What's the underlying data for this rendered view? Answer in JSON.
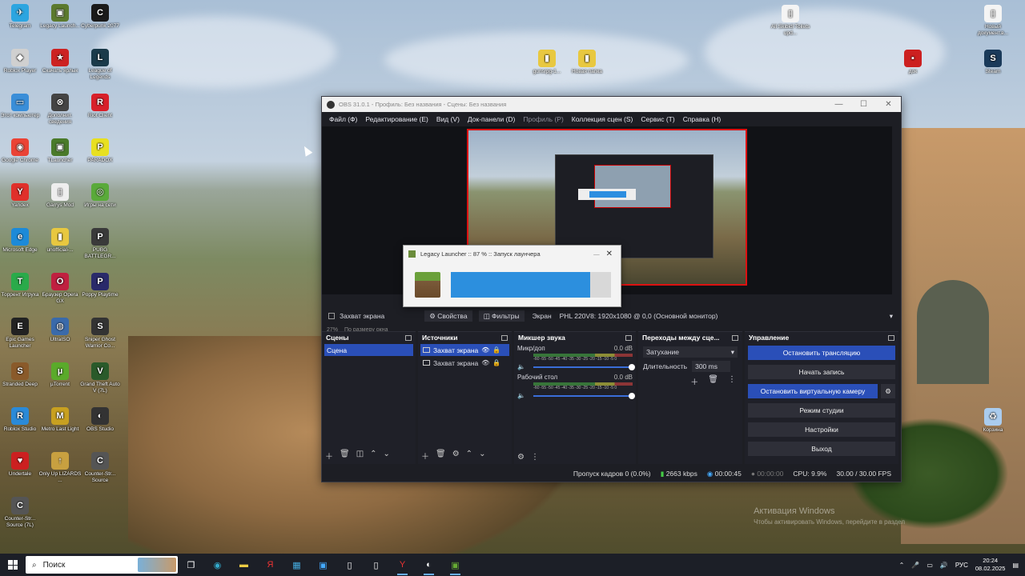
{
  "desktop": {
    "icons_left": [
      {
        "label": "Telegram",
        "color": "#2ca5e0",
        "glyph": "✈"
      },
      {
        "label": "Legacy Launch...",
        "color": "#5c7a2f",
        "glyph": "▣"
      },
      {
        "label": "Cyberpunk 2077",
        "color": "#1a1a1a",
        "glyph": "C"
      },
      {
        "label": "Roblox Player",
        "color": "#d0d0d0",
        "glyph": "◆"
      },
      {
        "label": "Скачать ярлык",
        "color": "#cc2222",
        "glyph": "★"
      },
      {
        "label": "League of Legends",
        "color": "#1a3a4a",
        "glyph": "L"
      },
      {
        "label": "Этот компьютер",
        "color": "#3a8ed8",
        "glyph": "▭"
      },
      {
        "label": "Дополнит. сведения",
        "color": "#444",
        "glyph": "⊗"
      },
      {
        "label": "Riot Client",
        "color": "#d8202a",
        "glyph": "R"
      },
      {
        "label": "Google Chrome",
        "color": "#ea4335",
        "glyph": "◉"
      },
      {
        "label": "TLauncher",
        "color": "#4a7a2a",
        "glyph": "▣"
      },
      {
        "label": "PARADOX",
        "color": "#e8e020",
        "glyph": "P"
      },
      {
        "label": "Yandex",
        "color": "#e0302a",
        "glyph": "Y"
      },
      {
        "label": "Garrys Mod",
        "color": "#eee",
        "glyph": "▯"
      },
      {
        "label": "Игры на сети",
        "color": "#5aaa3a",
        "glyph": "◎"
      },
      {
        "label": "Microsoft Edge",
        "color": "#1c8ad8",
        "glyph": "e"
      },
      {
        "label": "unofficial-...",
        "color": "#e8c840",
        "glyph": "▮"
      },
      {
        "label": "PUBG BATTLEGR...",
        "color": "#3a3a3a",
        "glyph": "P"
      },
      {
        "label": "Торрент Игруха",
        "color": "#2aaa4a",
        "glyph": "T"
      },
      {
        "label": "Браузер Opera GX",
        "color": "#c02040",
        "glyph": "O"
      },
      {
        "label": "Poppy Playtime",
        "color": "#2a2a6a",
        "glyph": "P"
      },
      {
        "label": "Epic Games Launcher",
        "color": "#222",
        "glyph": "E"
      },
      {
        "label": "UltraISO",
        "color": "#3a6aaa",
        "glyph": "◍"
      },
      {
        "label": "Sniper Ghost Warrior Co...",
        "color": "#333",
        "glyph": "S"
      },
      {
        "label": "Stranded Deep",
        "color": "#8a5a2a",
        "glyph": "S"
      },
      {
        "label": "µTorrent",
        "color": "#5aaa2a",
        "glyph": "µ"
      },
      {
        "label": "Grand Theft Auto V (7L)",
        "color": "#2a5a2a",
        "glyph": "V"
      },
      {
        "label": "Roblox Studio",
        "color": "#2a8ad8",
        "glyph": "R"
      },
      {
        "label": "Metro Last Light",
        "color": "#c8a020",
        "glyph": "M"
      },
      {
        "label": "OBS Studio",
        "color": "#333",
        "glyph": "◐"
      },
      {
        "label": "Undertale",
        "color": "#cc2020",
        "glyph": "♥"
      },
      {
        "label": "Only Up LIZARDS ...",
        "color": "#c8a040",
        "glyph": "↑"
      },
      {
        "label": "Counter-Str... Source",
        "color": "#555",
        "glyph": "C"
      },
      {
        "label": "Counter-Str... Source (7L)",
        "color": "#555",
        "glyph": "C"
      }
    ],
    "icons_mid": [
      {
        "label": "gunsrpg-1...",
        "color": "#e8c840",
        "glyph": "▮"
      },
      {
        "label": "Новая папка",
        "color": "#e8c840",
        "glyph": "▮"
      }
    ],
    "icons_right": [
      {
        "label": "All Skibidi Toilets upd...",
        "color": "#f4f4f4",
        "glyph": "▯"
      },
      {
        "label": "Новый документ.в...",
        "color": "#f4f4f4",
        "glyph": "▯"
      },
      {
        "label": "док",
        "color": "#cc2020",
        "glyph": "▪"
      },
      {
        "label": "Steam",
        "color": "#1a3a5a",
        "glyph": "S"
      },
      {
        "label": "Корзина",
        "color": "#aaccee",
        "glyph": "♻"
      }
    ],
    "watermark_title": "Активация Windows",
    "watermark_sub": "Чтобы активировать Windows, перейдите в раздел"
  },
  "obs": {
    "title": "OBS 31.0.1 - Профиль: Без названия - Сцены: Без названия",
    "menu": [
      {
        "label": "Файл (Ф)",
        "dim": false
      },
      {
        "label": "Редактирование (Е)",
        "dim": false
      },
      {
        "label": "Вид (V)",
        "dim": false
      },
      {
        "label": "Док-панели (D)",
        "dim": false
      },
      {
        "label": "Профиль (P)",
        "dim": true
      },
      {
        "label": "Коллекция сцен (S)",
        "dim": false
      },
      {
        "label": "Сервис (T)",
        "dim": false
      },
      {
        "label": "Справка (H)",
        "dim": false
      }
    ],
    "zoom": "27%",
    "zoom_mode": "По размеру окна",
    "source_bar": {
      "source_name": "Захват экрана",
      "properties": "Свойства",
      "filters": "Фильтры",
      "screen_label": "Экран",
      "screen_value": "PHL 220V8: 1920x1080 @ 0,0 (Основной монитор)"
    },
    "scenes": {
      "title": "Сцены",
      "items": [
        "Сцена"
      ]
    },
    "sources": {
      "title": "Источники",
      "items": [
        "Захват экрана",
        "Захват экрана"
      ]
    },
    "mixer": {
      "title": "Микшер звука",
      "ticks": "-60 -55 -50 -45 -40 -35 -30 -25 -20 -15 -10 -5 0",
      "channels": [
        {
          "name": "Микр/доп",
          "db": "0.0 dB"
        },
        {
          "name": "Рабочий стол",
          "db": "0.0 dB"
        }
      ]
    },
    "transitions": {
      "title": "Переходы между сце...",
      "type": "Затухание",
      "duration_label": "Длительность",
      "duration": "300 ms"
    },
    "controls": {
      "title": "Управление",
      "buttons": [
        {
          "label": "Остановить трансляцию",
          "active": true
        },
        {
          "label": "Начать запись",
          "active": false
        },
        {
          "label": "Остановить виртуальную камеру",
          "active": true
        },
        {
          "label": "Режим студии",
          "active": false
        },
        {
          "label": "Настройки",
          "active": false
        },
        {
          "label": "Выход",
          "active": false
        }
      ]
    },
    "status": {
      "dropped": "Пропуск кадров 0 (0.0%)",
      "bitrate": "2663 kbps",
      "stream_time": "00:00:45",
      "rec_time": "00:00:00",
      "cpu": "CPU: 9.9%",
      "fps": "30.00 / 30.00 FPS"
    }
  },
  "launcher": {
    "title": "Legacy Launcher :: 87 % :: Запуск лаунчера",
    "progress": 0.87
  },
  "taskbar": {
    "search_placeholder": "Поиск",
    "lang": "РУС",
    "time": "20:24",
    "date": "08.02.2025"
  }
}
